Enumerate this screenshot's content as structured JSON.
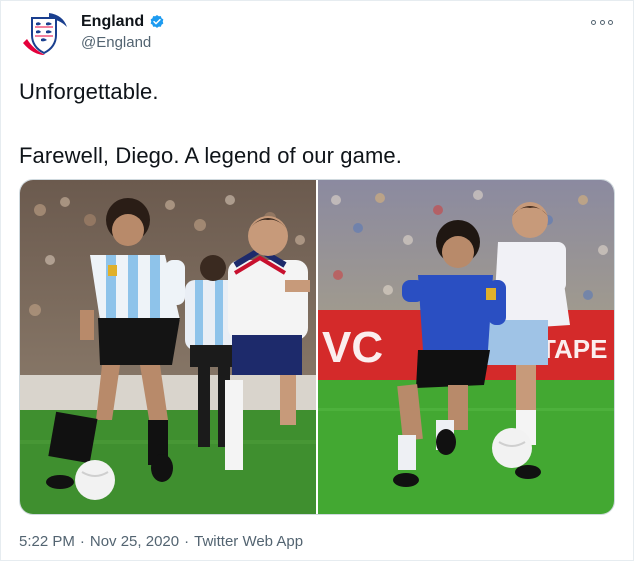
{
  "tweet": {
    "display_name": "England",
    "handle": "@England",
    "verified": true,
    "line1": "Unforgettable.",
    "line2": "Farewell, Diego. A legend of our game.",
    "time": "5:22 PM",
    "date": "Nov 25, 2020",
    "separator": "·",
    "source": "Twitter Web App"
  },
  "icons": {
    "avatar": "england-crest-icon",
    "verified": "verified-badge-icon",
    "more": "more-options-icon"
  },
  "colors": {
    "verified_blue": "#1d9bf0",
    "secondary_text": "#536471",
    "pitch_green": "#3f8f2f",
    "argentina_stripe": "#8ec3ea",
    "argentina_away_blue": "#2a4fc2",
    "england_navy": "#1d2a6b",
    "advert_red": "#d42a2a"
  }
}
